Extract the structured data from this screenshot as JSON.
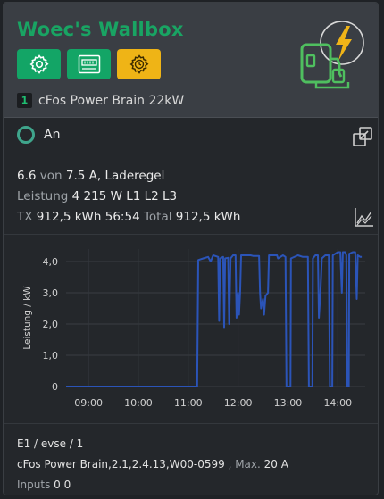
{
  "header": {
    "title": "Woec's Wallbox",
    "device_number": "1",
    "device_name": "cFos Power Brain 22kW"
  },
  "status": {
    "state": "An"
  },
  "info": {
    "current": "6.6",
    "von": "von",
    "max_current": "7.5 A, Laderegel",
    "leistung_label": "Leistung",
    "power": "4 215 W L1 L2 L3",
    "tx_label": "TX",
    "tx_value": "912,5 kWh 56:54",
    "total_label": "Total",
    "total_value": "912,5 kWh"
  },
  "chart_data": {
    "type": "line",
    "ylabel": "Leistung / kW",
    "xlabel": "",
    "x_ticks": [
      "09:00",
      "10:00",
      "11:00",
      "12:00",
      "13:00",
      "14:00"
    ],
    "y_ticks": [
      "0",
      "1,0",
      "2,0",
      "3,0",
      "4,0"
    ],
    "ylim": [
      0,
      4.4
    ],
    "xlim": [
      8.55,
      14.55
    ],
    "grid": true,
    "series": [
      {
        "color": "#2b54b8",
        "points": [
          [
            8.55,
            0
          ],
          [
            11.18,
            0
          ],
          [
            11.2,
            4.05
          ],
          [
            11.3,
            4.1
          ],
          [
            11.4,
            4.15
          ],
          [
            11.45,
            4.0
          ],
          [
            11.5,
            4.2
          ],
          [
            11.6,
            4.15
          ],
          [
            11.62,
            2.1
          ],
          [
            11.64,
            4.1
          ],
          [
            11.7,
            4.15
          ],
          [
            11.72,
            1.9
          ],
          [
            11.74,
            4.1
          ],
          [
            11.8,
            4.12
          ],
          [
            11.82,
            2.0
          ],
          [
            11.85,
            4.1
          ],
          [
            11.9,
            4.2
          ],
          [
            11.95,
            4.2
          ],
          [
            11.97,
            2.2
          ],
          [
            12.0,
            3.0
          ],
          [
            12.02,
            2.3
          ],
          [
            12.04,
            3.0
          ],
          [
            12.06,
            4.2
          ],
          [
            12.25,
            4.2
          ],
          [
            12.3,
            4.18
          ],
          [
            12.42,
            4.18
          ],
          [
            12.44,
            3.0
          ],
          [
            12.46,
            2.5
          ],
          [
            12.5,
            2.8
          ],
          [
            12.52,
            2.3
          ],
          [
            12.55,
            2.9
          ],
          [
            12.6,
            3.0
          ],
          [
            12.62,
            4.2
          ],
          [
            12.78,
            4.2
          ],
          [
            12.8,
            4.1
          ],
          [
            12.9,
            4.2
          ],
          [
            12.95,
            4.15
          ],
          [
            12.97,
            0
          ],
          [
            13.05,
            0
          ],
          [
            13.06,
            4.1
          ],
          [
            13.2,
            4.2
          ],
          [
            13.3,
            4.15
          ],
          [
            13.4,
            4.15
          ],
          [
            13.42,
            0
          ],
          [
            13.49,
            0
          ],
          [
            13.5,
            4.1
          ],
          [
            13.55,
            4.2
          ],
          [
            13.6,
            4.2
          ],
          [
            13.62,
            2.2
          ],
          [
            13.65,
            3.0
          ],
          [
            13.68,
            4.1
          ],
          [
            13.75,
            4.2
          ],
          [
            13.82,
            4.2
          ],
          [
            13.84,
            0
          ],
          [
            13.89,
            0
          ],
          [
            13.9,
            4.2
          ],
          [
            14.0,
            4.3
          ],
          [
            14.05,
            4.3
          ],
          [
            14.08,
            3.0
          ],
          [
            14.1,
            4.3
          ],
          [
            14.15,
            4.3
          ],
          [
            14.17,
            4.2
          ],
          [
            14.19,
            0
          ],
          [
            14.22,
            0
          ],
          [
            14.23,
            4.25
          ],
          [
            14.3,
            4.3
          ],
          [
            14.35,
            4.3
          ],
          [
            14.38,
            2.8
          ],
          [
            14.4,
            4.2
          ],
          [
            14.45,
            4.15
          ],
          [
            14.48,
            4.15
          ]
        ]
      }
    ]
  },
  "footer": {
    "line1": "E1 / evse / 1",
    "device_info": "cFos Power Brain,2.1,2.4.13,W00-0599",
    "max_label": ", Max.",
    "max_value": "20 A",
    "inputs_label": "Inputs",
    "inputs_value": "0 0"
  }
}
